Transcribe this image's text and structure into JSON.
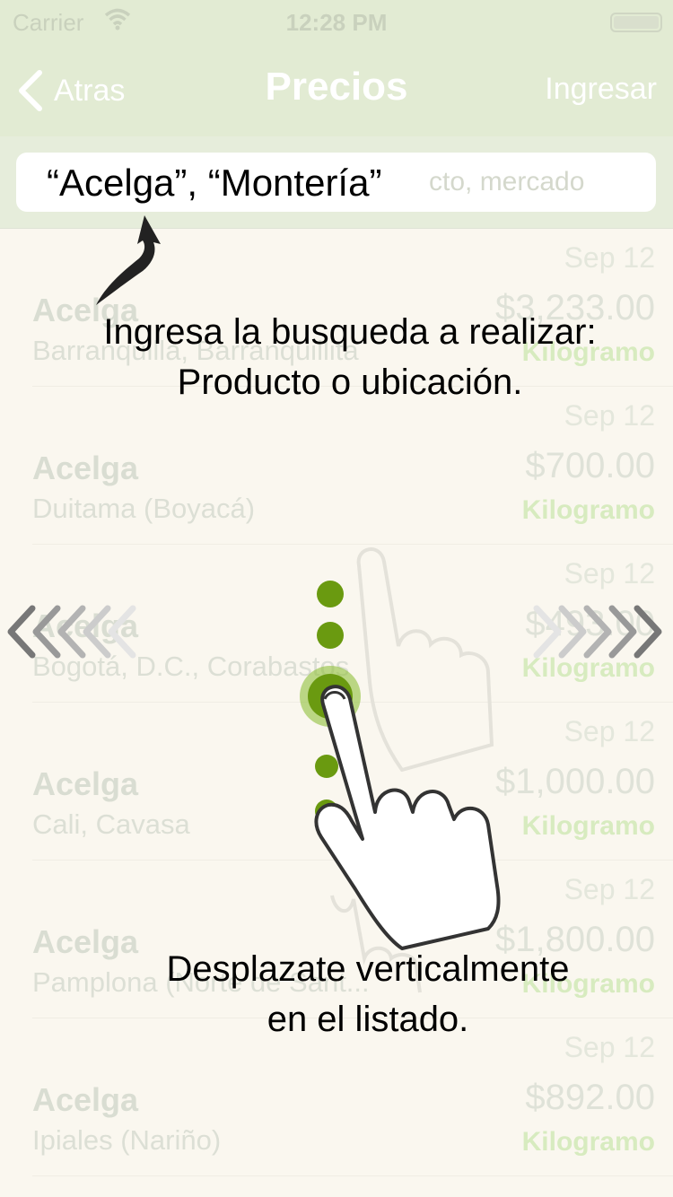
{
  "status_bar": {
    "carrier": "Carrier",
    "time": "12:28 PM",
    "wifi_icon": "wifi-icon",
    "battery_icon": "battery-icon"
  },
  "nav": {
    "back_label": "Atras",
    "title": "Precios",
    "right_label": "Ingresar"
  },
  "search": {
    "placeholder_visible": "cto, mercado",
    "typed_example": "“Acelga”, “Montería”"
  },
  "rows": [
    {
      "date": "Sep 12",
      "product": "Acelga",
      "price": "$3,233.00",
      "location": "Barranquilla, Barranquillita",
      "unit": "Kilogramo"
    },
    {
      "date": "Sep 12",
      "product": "Acelga",
      "price": "$700.00",
      "location": "Duitama (Boyacá)",
      "unit": "Kilogramo"
    },
    {
      "date": "Sep 12",
      "product": "Acelga",
      "price": "$493.00",
      "location": "Bogotá, D.C., Corabastos",
      "unit": "Kilogramo"
    },
    {
      "date": "Sep 12",
      "product": "Acelga",
      "price": "$1,000.00",
      "location": "Cali, Cavasa",
      "unit": "Kilogramo"
    },
    {
      "date": "Sep 12",
      "product": "Acelga",
      "price": "$1,800.00",
      "location": "Pamplona (Norte de Sant...",
      "unit": "Kilogramo"
    },
    {
      "date": "Sep 12",
      "product": "Acelga",
      "price": "$892.00",
      "location": "Ipiales (Nariño)",
      "unit": "Kilogramo"
    }
  ],
  "tutorial": {
    "search_hint_line1": "Ingresa la busqueda a realizar:",
    "search_hint_line2": "Producto o ubicación.",
    "scroll_hint_line1": "Desplazate verticalmente",
    "scroll_hint_line2": "en el listado."
  },
  "colors": {
    "nav_bg": "#e2ebd3",
    "accent_green": "#6a9a10",
    "unit_green": "#d7ebbf"
  }
}
